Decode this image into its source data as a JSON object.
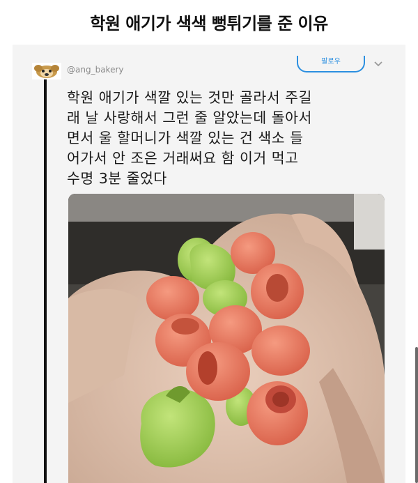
{
  "post": {
    "title": "학원 애기가 색색 뻥튀기를 준 이유"
  },
  "tweet": {
    "handle": "@ang_bakery",
    "follow_label": "팔로우",
    "text_lines": [
      "학원 애기가 색깔 있는 것만 골라서 주길",
      "래 날 사랑해서 그런 줄 알았는데 돌아서",
      "면서 울 할머니가 색깔 있는 건 색소 들",
      "어가서 안 조은 거래써요 함 이거 먹고",
      "수명 3분 줄었다"
    ],
    "avatar_icon": "character-avatar-icon",
    "menu_icon": "chevron-down-icon"
  },
  "photo": {
    "description_icon": "hand-holding-colored-puffed-snacks"
  },
  "colors": {
    "follow_accent": "#2b8fe0",
    "snack_pink": "#e8775c",
    "snack_green": "#9ccc4e"
  }
}
